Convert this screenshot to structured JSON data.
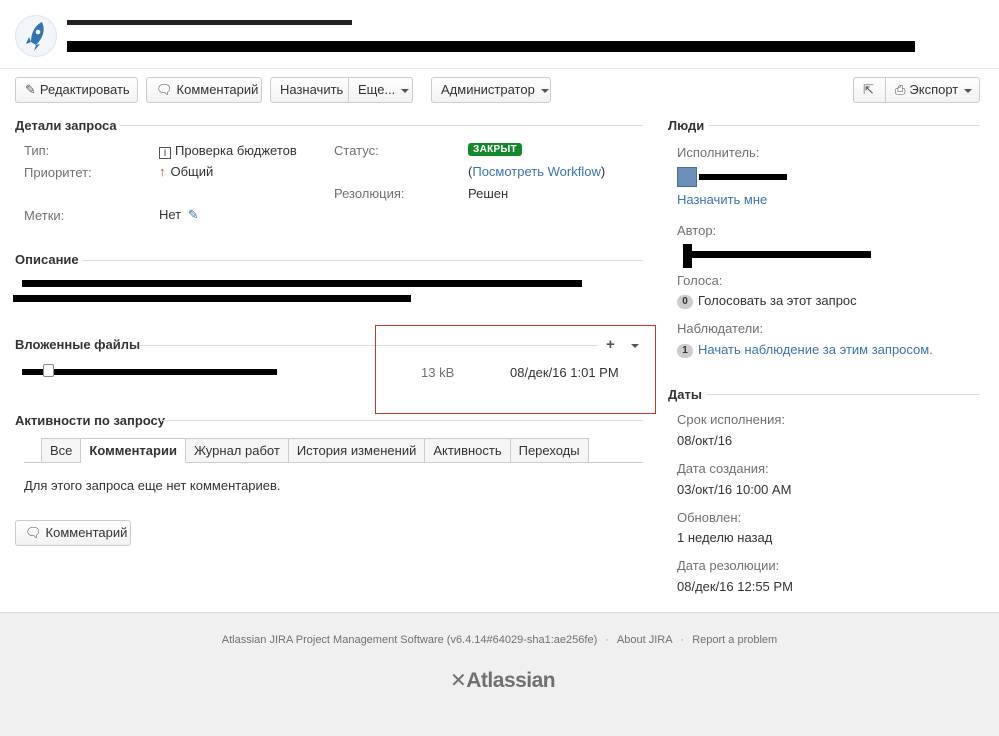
{
  "header": {
    "breadcrumb": "",
    "title": ""
  },
  "toolbar": {
    "edit": "Редактировать",
    "comment": "Комментарий",
    "assign": "Назначить",
    "more": "Еще...",
    "admin": "Администратор",
    "export": "Экспорт"
  },
  "details": {
    "heading": "Детали запроса",
    "type_label": "Тип:",
    "type_value": "Проверка бюджетов",
    "priority_label": "Приоритет:",
    "priority_value": "Общий",
    "labels_label": "Метки:",
    "labels_value": "Нет",
    "status_label": "Статус:",
    "status_value": "ЗАКРЫТ",
    "workflow_link": "Посмотреть Workflow",
    "resolution_label": "Резолюция:",
    "resolution_value": "Решен"
  },
  "description": {
    "heading": "Описание"
  },
  "attachments": {
    "heading": "Вложенные файлы",
    "file_size": "13 kB",
    "file_date": "08/дек/16 1:01 PM"
  },
  "activity": {
    "heading": "Активности по запросу",
    "tabs": [
      "Все",
      "Комментарии",
      "Журнал работ",
      "История изменений",
      "Активность",
      "Переходы"
    ],
    "active_tab": "Комментарии",
    "empty": "Для этого запроса еще нет комментариев.",
    "comment_button": "Комментарий"
  },
  "people": {
    "heading": "Люди",
    "assignee_label": "Исполнитель:",
    "assign_me": "Назначить мне",
    "author_label": "Автор:",
    "votes_label": "Голоса:",
    "votes_count": "0",
    "vote_link": "Голосовать за этот запрос",
    "watchers_label": "Наблюдатели:",
    "watchers_count": "1",
    "watch_link": "Начать наблюдение за этим запросом."
  },
  "dates": {
    "heading": "Даты",
    "due_label": "Срок исполнения:",
    "due_value": "08/окт/16",
    "created_label": "Дата создания:",
    "created_value": "03/окт/16 10:00 AM",
    "updated_label": "Обновлен:",
    "updated_value": "1 неделю назад",
    "resolved_label": "Дата резолюции:",
    "resolved_value": "08/дек/16 12:55 PM"
  },
  "footer": {
    "software": "Atlassian JIRA Project Management Software (v6.4.14#64029-sha1:ae256fe)",
    "about": "About JIRA",
    "report": "Report a problem",
    "logo": "Atlassian"
  },
  "colors": {
    "link": "#3b73af",
    "status_closed": "#14892c",
    "highlight_box": "#c0392b"
  }
}
